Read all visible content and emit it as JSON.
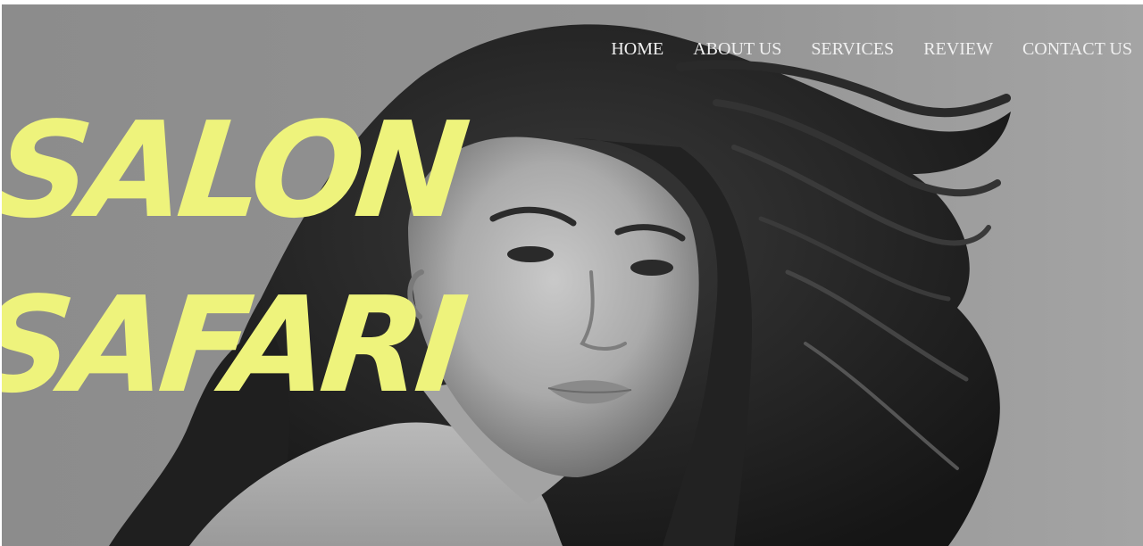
{
  "nav": {
    "items": [
      {
        "label": "HOME"
      },
      {
        "label": "ABOUT US"
      },
      {
        "label": "SERVICES"
      },
      {
        "label": "REVIEW"
      },
      {
        "label": "CONTACT US"
      }
    ]
  },
  "hero": {
    "title_line1": "SALON",
    "title_line2": "SAFARI",
    "image": "black-and-white portrait of a woman with long wavy windblown hair"
  },
  "colors": {
    "brand": "#eef37c",
    "nav_text": "#f0f0f0",
    "hero_background": "#8f8f8f"
  }
}
